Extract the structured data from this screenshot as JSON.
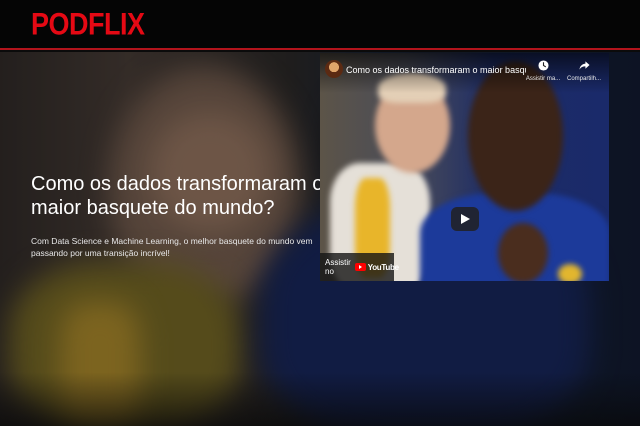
{
  "header": {
    "logo_text": "PODFLIX"
  },
  "hero": {
    "headline": "Como os dados transformaram o maior basquete do mundo?",
    "description": "Com Data Science e Machine Learning, o melhor basquete do mundo vem passando por uma transição incrível!"
  },
  "video": {
    "title": "Como os dados transformaram o maior basquete do ...",
    "watch_later_label": "Assistir ma...",
    "share_label": "Compartilh...",
    "watch_on_label": "Assistir no",
    "platform_label": "YouTube"
  },
  "colors": {
    "brand_red": "#e50914",
    "youtube_red": "#ff0000"
  }
}
